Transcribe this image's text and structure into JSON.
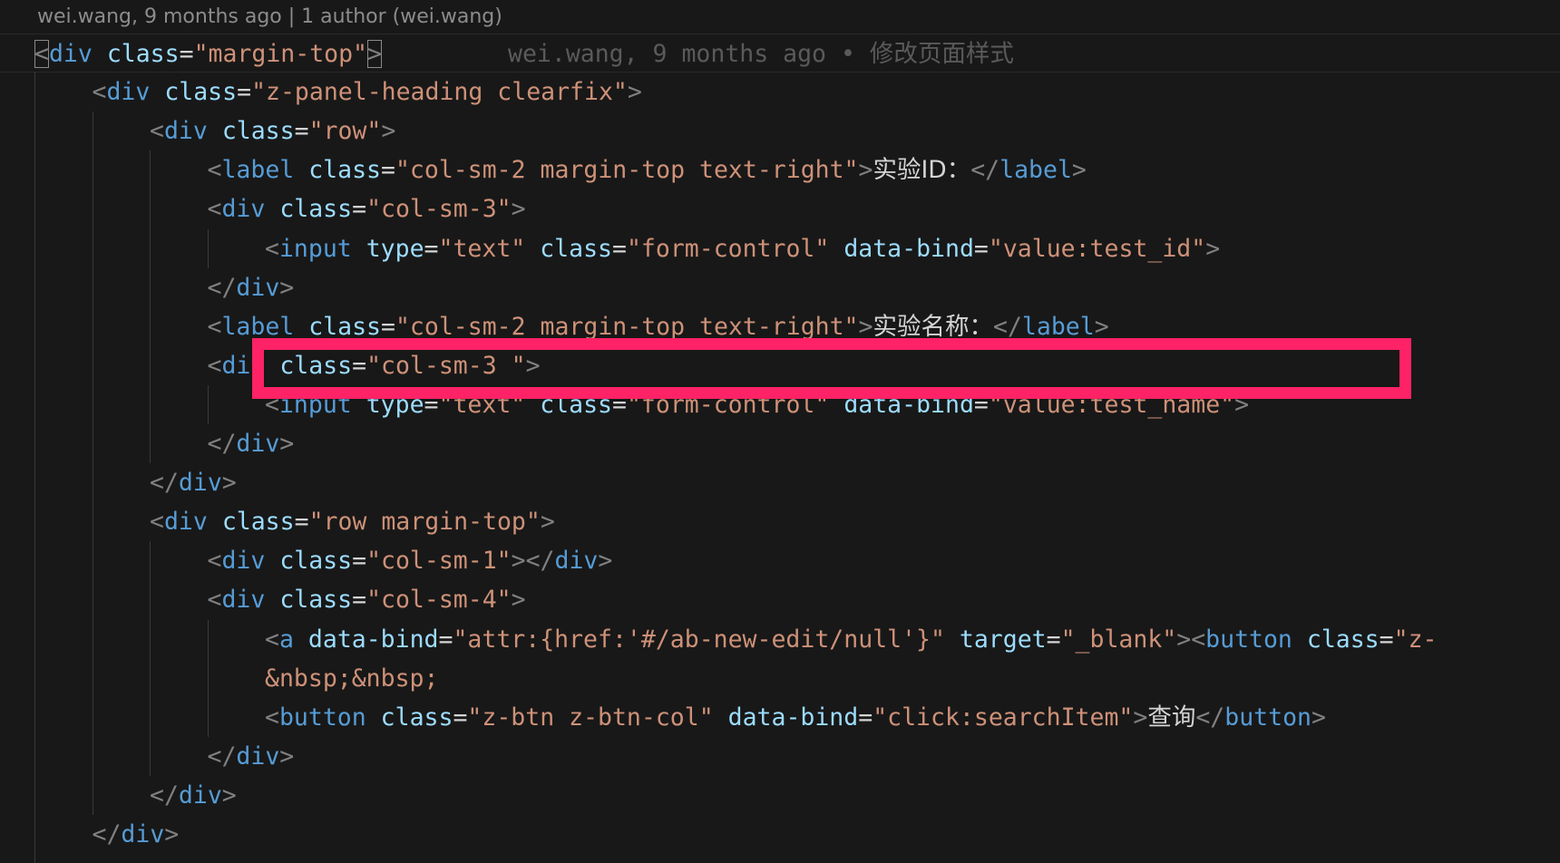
{
  "codelens": {
    "text": "wei.wang, 9 months ago | 1 author (wei.wang)"
  },
  "blame": {
    "text": "wei.wang, 9 months ago • 修改页面样式"
  },
  "annotation": {
    "highlighted_line": 10,
    "color": "#ff2266"
  },
  "theme": {
    "background": "#181818",
    "tag": "#569cd6",
    "attribute": "#9cdcfe",
    "string": "#ce9178",
    "punctuation": "#808080",
    "text": "#d4d4d4"
  },
  "lines": [
    {
      "indent": 0,
      "tokens": [
        [
          "p",
          "<"
        ],
        [
          "t",
          "div"
        ],
        [
          "s",
          " "
        ],
        [
          "a",
          "class"
        ],
        [
          "e",
          "="
        ],
        [
          "v",
          "\"margin-top\""
        ],
        [
          "p",
          ">"
        ]
      ]
    },
    {
      "indent": 1,
      "tokens": [
        [
          "p",
          "<"
        ],
        [
          "t",
          "div"
        ],
        [
          "s",
          " "
        ],
        [
          "a",
          "class"
        ],
        [
          "e",
          "="
        ],
        [
          "v",
          "\"z-panel-heading clearfix\""
        ],
        [
          "p",
          ">"
        ]
      ]
    },
    {
      "indent": 2,
      "tokens": [
        [
          "p",
          "<"
        ],
        [
          "t",
          "div"
        ],
        [
          "s",
          " "
        ],
        [
          "a",
          "class"
        ],
        [
          "e",
          "="
        ],
        [
          "v",
          "\"row\""
        ],
        [
          "p",
          ">"
        ]
      ]
    },
    {
      "indent": 3,
      "tokens": [
        [
          "p",
          "<"
        ],
        [
          "t",
          "label"
        ],
        [
          "s",
          " "
        ],
        [
          "a",
          "class"
        ],
        [
          "e",
          "="
        ],
        [
          "v",
          "\"col-sm-2 margin-top text-right\""
        ],
        [
          "p",
          ">"
        ],
        [
          "x",
          "实验ID："
        ],
        [
          "p",
          "</"
        ],
        [
          "t",
          "label"
        ],
        [
          "p",
          ">"
        ]
      ]
    },
    {
      "indent": 3,
      "tokens": [
        [
          "p",
          "<"
        ],
        [
          "t",
          "div"
        ],
        [
          "s",
          " "
        ],
        [
          "a",
          "class"
        ],
        [
          "e",
          "="
        ],
        [
          "v",
          "\"col-sm-3\""
        ],
        [
          "p",
          ">"
        ]
      ]
    },
    {
      "indent": 4,
      "tokens": [
        [
          "p",
          "<"
        ],
        [
          "t",
          "input"
        ],
        [
          "s",
          " "
        ],
        [
          "a",
          "type"
        ],
        [
          "e",
          "="
        ],
        [
          "v",
          "\"text\""
        ],
        [
          "s",
          " "
        ],
        [
          "a",
          "class"
        ],
        [
          "e",
          "="
        ],
        [
          "v",
          "\"form-control\""
        ],
        [
          "s",
          " "
        ],
        [
          "a",
          "data-bind"
        ],
        [
          "e",
          "="
        ],
        [
          "v",
          "\"value:test_id\""
        ],
        [
          "p",
          ">"
        ]
      ]
    },
    {
      "indent": 3,
      "tokens": [
        [
          "p",
          "</"
        ],
        [
          "t",
          "div"
        ],
        [
          "p",
          ">"
        ]
      ]
    },
    {
      "indent": 3,
      "tokens": [
        [
          "p",
          "<"
        ],
        [
          "t",
          "label"
        ],
        [
          "s",
          " "
        ],
        [
          "a",
          "class"
        ],
        [
          "e",
          "="
        ],
        [
          "v",
          "\"col-sm-2 margin-top text-right\""
        ],
        [
          "p",
          ">"
        ],
        [
          "x",
          "实验名称："
        ],
        [
          "p",
          "</"
        ],
        [
          "t",
          "label"
        ],
        [
          "p",
          ">"
        ]
      ]
    },
    {
      "indent": 3,
      "tokens": [
        [
          "p",
          "<"
        ],
        [
          "t",
          "div"
        ],
        [
          "s",
          " "
        ],
        [
          "a",
          "class"
        ],
        [
          "e",
          "="
        ],
        [
          "v",
          "\"col-sm-3 \""
        ],
        [
          "p",
          ">"
        ]
      ]
    },
    {
      "indent": 4,
      "tokens": [
        [
          "p",
          "<"
        ],
        [
          "t",
          "input"
        ],
        [
          "s",
          " "
        ],
        [
          "a",
          "type"
        ],
        [
          "e",
          "="
        ],
        [
          "v",
          "\"text\""
        ],
        [
          "s",
          " "
        ],
        [
          "a",
          "class"
        ],
        [
          "e",
          "="
        ],
        [
          "v",
          "\"form-control\""
        ],
        [
          "s",
          " "
        ],
        [
          "a",
          "data-bind"
        ],
        [
          "e",
          "="
        ],
        [
          "v",
          "\"value:test_name\""
        ],
        [
          "p",
          ">"
        ]
      ]
    },
    {
      "indent": 3,
      "tokens": [
        [
          "p",
          "</"
        ],
        [
          "t",
          "div"
        ],
        [
          "p",
          ">"
        ]
      ]
    },
    {
      "indent": 2,
      "tokens": [
        [
          "p",
          "</"
        ],
        [
          "t",
          "div"
        ],
        [
          "p",
          ">"
        ]
      ]
    },
    {
      "indent": 2,
      "tokens": [
        [
          "p",
          "<"
        ],
        [
          "t",
          "div"
        ],
        [
          "s",
          " "
        ],
        [
          "a",
          "class"
        ],
        [
          "e",
          "="
        ],
        [
          "v",
          "\"row margin-top\""
        ],
        [
          "p",
          ">"
        ]
      ]
    },
    {
      "indent": 3,
      "tokens": [
        [
          "p",
          "<"
        ],
        [
          "t",
          "div"
        ],
        [
          "s",
          " "
        ],
        [
          "a",
          "class"
        ],
        [
          "e",
          "="
        ],
        [
          "v",
          "\"col-sm-1\""
        ],
        [
          "p",
          "></"
        ],
        [
          "t",
          "div"
        ],
        [
          "p",
          ">"
        ]
      ]
    },
    {
      "indent": 3,
      "tokens": [
        [
          "p",
          "<"
        ],
        [
          "t",
          "div"
        ],
        [
          "s",
          " "
        ],
        [
          "a",
          "class"
        ],
        [
          "e",
          "="
        ],
        [
          "v",
          "\"col-sm-4\""
        ],
        [
          "p",
          ">"
        ]
      ]
    },
    {
      "indent": 4,
      "tokens": [
        [
          "p",
          "<"
        ],
        [
          "t",
          "a"
        ],
        [
          "s",
          " "
        ],
        [
          "a",
          "data-bind"
        ],
        [
          "e",
          "="
        ],
        [
          "v",
          "\"attr:{href:'#/ab-new-edit/null'}\""
        ],
        [
          "s",
          " "
        ],
        [
          "a",
          "target"
        ],
        [
          "e",
          "="
        ],
        [
          "v",
          "\"_blank\""
        ],
        [
          "p",
          "><"
        ],
        [
          "t",
          "button"
        ],
        [
          "s",
          " "
        ],
        [
          "a",
          "class"
        ],
        [
          "e",
          "="
        ],
        [
          "v",
          "\"z-"
        ]
      ]
    },
    {
      "indent": 4,
      "tokens": [
        [
          "v",
          "&nbsp;&nbsp;"
        ]
      ]
    },
    {
      "indent": 4,
      "tokens": [
        [
          "p",
          "<"
        ],
        [
          "t",
          "button"
        ],
        [
          "s",
          " "
        ],
        [
          "a",
          "class"
        ],
        [
          "e",
          "="
        ],
        [
          "v",
          "\"z-btn z-btn-col\""
        ],
        [
          "s",
          " "
        ],
        [
          "a",
          "data-bind"
        ],
        [
          "e",
          "="
        ],
        [
          "v",
          "\"click:searchItem\""
        ],
        [
          "p",
          ">"
        ],
        [
          "x",
          "查询"
        ],
        [
          "p",
          "</"
        ],
        [
          "t",
          "button"
        ],
        [
          "p",
          ">"
        ]
      ]
    },
    {
      "indent": 3,
      "tokens": [
        [
          "p",
          "</"
        ],
        [
          "t",
          "div"
        ],
        [
          "p",
          ">"
        ]
      ]
    },
    {
      "indent": 2,
      "tokens": [
        [
          "p",
          "</"
        ],
        [
          "t",
          "div"
        ],
        [
          "p",
          ">"
        ]
      ]
    },
    {
      "indent": 1,
      "tokens": [
        [
          "p",
          "</"
        ],
        [
          "t",
          "div"
        ],
        [
          "p",
          ">"
        ]
      ]
    }
  ]
}
